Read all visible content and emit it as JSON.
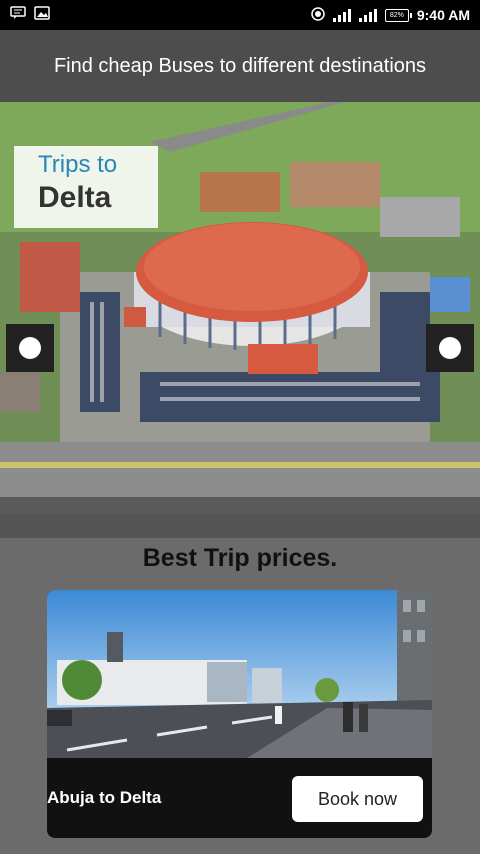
{
  "status_bar": {
    "battery": "82%",
    "time": "9:40 AM"
  },
  "header": {
    "title": "Find cheap Buses to different destinations"
  },
  "hero": {
    "caption_line1": "Trips to",
    "caption_line2": "Delta"
  },
  "section": {
    "title": "Best Trip prices."
  },
  "trip_card": {
    "route": "Abuja to Delta",
    "button_label": "Book now"
  }
}
